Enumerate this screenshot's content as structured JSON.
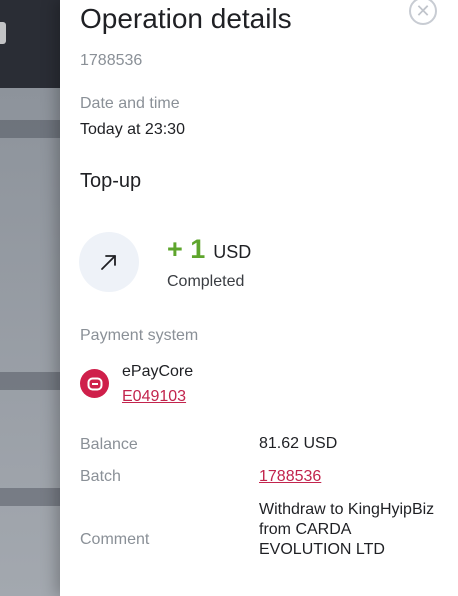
{
  "panel": {
    "title": "Operation details",
    "close_icon": "close-icon",
    "operation_id": "1788536",
    "datetime_label": "Date and time",
    "datetime_value": "Today at 23:30",
    "operation_type": "Top-up"
  },
  "summary": {
    "icon": "arrow-up-right-icon",
    "amount": "+ 1",
    "currency": "USD",
    "status": "Completed",
    "amount_color": "#5ea52c"
  },
  "payment": {
    "label": "Payment system",
    "name": "ePayCore",
    "account": "E049103",
    "logo_color": "#cf1f4a"
  },
  "details": {
    "balance_label": "Balance",
    "balance_value": "81.62 USD",
    "batch_label": "Batch",
    "batch_value": "1788536",
    "comment_label": "Comment",
    "comment_value": "Withdraw to KingHyipBiz from CARDA EVOLUTION LTD"
  }
}
